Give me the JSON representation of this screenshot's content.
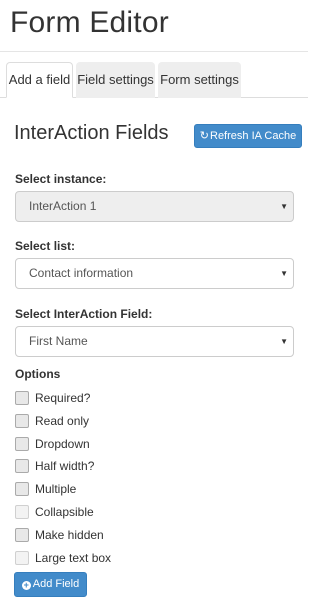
{
  "header": {
    "title": "Form Editor"
  },
  "tabs": [
    {
      "label": "Add a field",
      "active": true
    },
    {
      "label": "Field settings",
      "active": false
    },
    {
      "label": "Form settings",
      "active": false
    }
  ],
  "section": {
    "title": "InterAction Fields",
    "refresh_button": {
      "label": "Refresh IA Cache",
      "icon": "refresh-icon"
    }
  },
  "fields": {
    "instance": {
      "label": "Select instance:",
      "value": "InterAction 1",
      "disabled": true
    },
    "list": {
      "label": "Select list:",
      "value": "Contact information"
    },
    "ia_field": {
      "label": "Select InterAction Field:",
      "value": "First Name"
    }
  },
  "options": {
    "label": "Options",
    "items": [
      {
        "label": "Required?",
        "checked": false,
        "enabled": true
      },
      {
        "label": "Read only",
        "checked": false,
        "enabled": true
      },
      {
        "label": "Dropdown",
        "checked": false,
        "enabled": true
      },
      {
        "label": "Half width?",
        "checked": false,
        "enabled": true
      },
      {
        "label": "Multiple",
        "checked": false,
        "enabled": true
      },
      {
        "label": "Collapsible",
        "checked": false,
        "enabled": false
      },
      {
        "label": "Make hidden",
        "checked": false,
        "enabled": true
      },
      {
        "label": "Large text box",
        "checked": false,
        "enabled": false
      }
    ]
  },
  "add_button": {
    "label": "Add Field",
    "icon": "plus-circle-icon"
  },
  "colors": {
    "primary": "#428bca",
    "primary_border": "#357ebd",
    "disabled_bg": "#eeeeee"
  }
}
